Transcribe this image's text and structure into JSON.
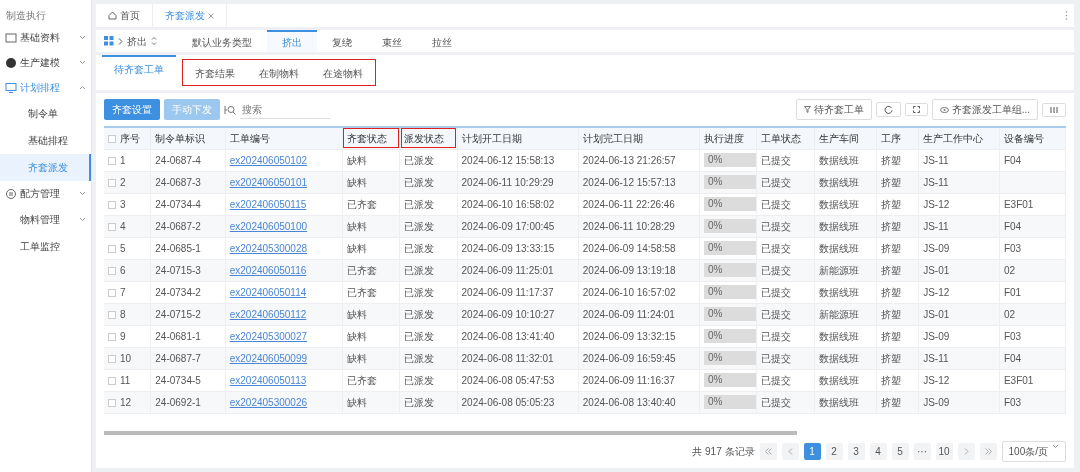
{
  "sidebar": {
    "title": "制造执行",
    "items": [
      {
        "kind": "group",
        "label": "基础资料",
        "expanded": false,
        "selected": false
      },
      {
        "kind": "group",
        "label": "生产建模",
        "expanded": false,
        "selected": false
      },
      {
        "kind": "group",
        "label": "计划排程",
        "expanded": true,
        "selected": true,
        "children": [
          {
            "label": "制令单",
            "selected": false
          },
          {
            "label": "基础排程",
            "selected": false
          },
          {
            "label": "齐套派发",
            "selected": true
          }
        ]
      },
      {
        "kind": "group",
        "label": "配方管理",
        "expanded": false,
        "selected": false
      },
      {
        "kind": "plain",
        "label": "物料管理",
        "expanded": false
      },
      {
        "kind": "plain",
        "label": "工单监控"
      }
    ]
  },
  "page_tabs": [
    {
      "kind": "home",
      "label": "首页",
      "selected": false
    },
    {
      "kind": "closable",
      "label": "齐套派发",
      "selected": true
    }
  ],
  "process_selector": {
    "label": "挤出"
  },
  "process_tabs": [
    {
      "label": "默认业务类型",
      "selected": false
    },
    {
      "label": "挤出",
      "selected": true
    },
    {
      "label": "复绕",
      "selected": false
    },
    {
      "label": "束丝",
      "selected": false
    },
    {
      "label": "拉丝",
      "selected": false
    }
  ],
  "sub_tabs": [
    {
      "label": "待齐套工单",
      "selected": true,
      "highlighted": false
    },
    {
      "label": "齐套结果",
      "selected": false,
      "highlighted": true
    },
    {
      "label": "在制物料",
      "selected": false,
      "highlighted": true
    },
    {
      "label": "在途物料",
      "selected": false,
      "highlighted": true
    }
  ],
  "toolbar": {
    "buttons": [
      {
        "label": "齐套设置",
        "disabled": false
      },
      {
        "label": "手动下发",
        "disabled": true
      }
    ],
    "search": {
      "placeholder": "搜索"
    },
    "filter": {
      "label": "待齐套工单"
    },
    "view": {
      "label": "齐套派发工单组..."
    }
  },
  "table": {
    "columns": [
      {
        "label": "序号",
        "highlighted": false
      },
      {
        "label": "制令单标识",
        "highlighted": false
      },
      {
        "label": "工单编号",
        "highlighted": false
      },
      {
        "label": "齐套状态",
        "highlighted": true
      },
      {
        "label": "派发状态",
        "highlighted": true
      },
      {
        "label": "计划开工日期",
        "highlighted": false
      },
      {
        "label": "计划完工日期",
        "highlighted": false
      },
      {
        "label": "执行进度",
        "highlighted": false
      },
      {
        "label": "工单状态",
        "highlighted": false
      },
      {
        "label": "生产车间",
        "highlighted": false
      },
      {
        "label": "工序",
        "highlighted": false
      },
      {
        "label": "生产工作中心",
        "highlighted": false
      },
      {
        "label": "设备编号",
        "highlighted": false
      }
    ],
    "rows": [
      {
        "no": "1",
        "order": "24-0687-4",
        "work_order": "ex202406050102",
        "kit": "缺料",
        "dispatch": "已派发",
        "start": "2024-06-12 15:58:13",
        "end": "2024-06-13 21:26:57",
        "level": 0,
        "progress": "0%",
        "status": "已提交",
        "workshop": "数据线班",
        "process": "挤塑",
        "center": "JS-11",
        "equipment": "F04",
        "checked": false
      },
      {
        "no": "2",
        "order": "24-0687-3",
        "work_order": "ex202406050101",
        "kit": "缺料",
        "dispatch": "已派发",
        "start": "2024-06-11 10:29:29",
        "end": "2024-06-12 15:57:13",
        "level": 0,
        "progress": "0%",
        "status": "已提交",
        "workshop": "数据线班",
        "process": "挤塑",
        "center": "JS-11",
        "checked": false
      },
      {
        "no": "3",
        "order": "24-0734-4",
        "work_order": "ex202406050115",
        "kit": "已齐套",
        "dispatch": "已派发",
        "start": "2024-06-10 16:58:02",
        "end": "2024-06-11 22:26:46",
        "level": 0,
        "progress": "0%",
        "status": "已提交",
        "workshop": "数据线班",
        "process": "挤塑",
        "center": "JS-12",
        "equipment": "E3F01",
        "checked": false
      },
      {
        "no": "4",
        "order": "24-0687-2",
        "work_order": "ex202406050100",
        "kit": "缺料",
        "dispatch": "已派发",
        "start": "2024-06-09 17:00:45",
        "end": "2024-06-11 10:28:29",
        "level": 0,
        "progress": "0%",
        "status": "已提交",
        "workshop": "数据线班",
        "process": "挤塑",
        "center": "JS-11",
        "equipment": "F04",
        "checked": false
      },
      {
        "no": "5",
        "order": "24-0685-1",
        "work_order": "ex202405300028",
        "kit": "缺料",
        "dispatch": "已派发",
        "start": "2024-06-09 13:33:15",
        "end": "2024-06-09 14:58:58",
        "level": 0,
        "progress": "0%",
        "status": "已提交",
        "workshop": "数据线班",
        "process": "挤塑",
        "center": "JS-09",
        "equipment": "F03",
        "checked": false
      },
      {
        "no": "6",
        "order": "24-0715-3",
        "work_order": "ex202406050116",
        "kit": "已齐套",
        "dispatch": "已派发",
        "start": "2024-06-09 11:25:01",
        "end": "2024-06-09 13:19:18",
        "level": 0,
        "progress": "0%",
        "status": "已提交",
        "workshop": "新能源班",
        "process": "挤塑",
        "center": "JS-01",
        "equipment": "02",
        "checked": false
      },
      {
        "no": "7",
        "order": "24-0734-2",
        "work_order": "ex202406050114",
        "kit": "已齐套",
        "dispatch": "已派发",
        "start": "2024-06-09 11:17:37",
        "end": "2024-06-10 16:57:02",
        "level": 0,
        "progress": "0%",
        "status": "已提交",
        "workshop": "数据线班",
        "process": "挤塑",
        "center": "JS-12",
        "equipment": "F01",
        "checked": false
      },
      {
        "no": "8",
        "order": "24-0715-2",
        "work_order": "ex202406050112",
        "kit": "缺料",
        "dispatch": "已派发",
        "start": "2024-06-09 10:10:27",
        "end": "2024-06-09 11:24:01",
        "level": 0,
        "progress": "0%",
        "status": "已提交",
        "workshop": "新能源班",
        "process": "挤塑",
        "center": "JS-01",
        "equipment": "02",
        "checked": false
      },
      {
        "no": "9",
        "order": "24-0681-1",
        "work_order": "ex202405300027",
        "kit": "缺料",
        "dispatch": "已派发",
        "start": "2024-06-08 13:41:40",
        "end": "2024-06-09 13:32:15",
        "level": 0,
        "progress": "0%",
        "status": "已提交",
        "workshop": "数据线班",
        "process": "挤塑",
        "center": "JS-09",
        "equipment": "F03",
        "checked": false
      },
      {
        "no": "10",
        "order": "24-0687-7",
        "work_order": "ex202406050099",
        "kit": "缺料",
        "dispatch": "已派发",
        "start": "2024-06-08 11:32:01",
        "end": "2024-06-09 16:59:45",
        "level": 0,
        "progress": "0%",
        "status": "已提交",
        "workshop": "数据线班",
        "process": "挤塑",
        "center": "JS-11",
        "equipment": "F04",
        "checked": false
      },
      {
        "no": "11",
        "order": "24-0734-5",
        "work_order": "ex202406050113",
        "kit": "已齐套",
        "dispatch": "已派发",
        "start": "2024-06-08 05:47:53",
        "end": "2024-06-09 11:16:37",
        "level": 0,
        "progress": "0%",
        "status": "已提交",
        "workshop": "数据线班",
        "process": "挤塑",
        "center": "JS-12",
        "equipment": "E3F01",
        "checked": false
      },
      {
        "no": "12",
        "order": "24-0692-1",
        "work_order": "ex202405300026",
        "kit": "缺料",
        "dispatch": "已派发",
        "start": "2024-06-08 05:05:23",
        "end": "2024-06-08 13:40:40",
        "level": 0,
        "progress": "0%",
        "status": "已提交",
        "workshop": "数据线班",
        "process": "挤塑",
        "center": "JS-09",
        "equipment": "F03",
        "checked": false
      }
    ]
  },
  "pagination": {
    "total": "共 917 条记录",
    "pages": [
      {
        "label": "1",
        "selected": true
      },
      {
        "label": "2",
        "selected": false
      },
      {
        "label": "3",
        "selected": false
      },
      {
        "label": "4",
        "selected": false
      },
      {
        "label": "5",
        "selected": false
      },
      {
        "label": "···",
        "selected": false
      },
      {
        "label": "10",
        "selected": false
      }
    ],
    "page_size": "100条/页"
  }
}
